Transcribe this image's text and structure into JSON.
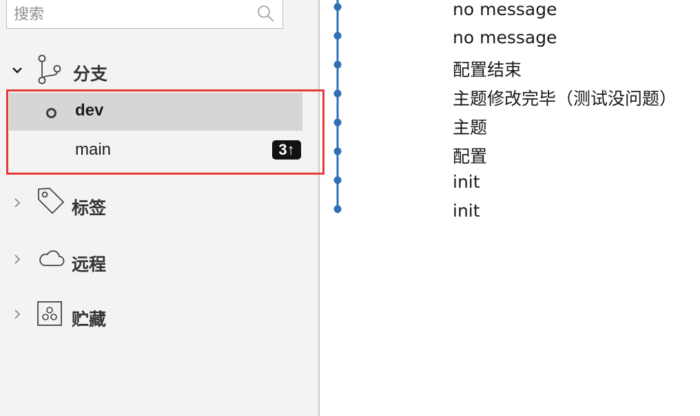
{
  "sidebar": {
    "search_placeholder": "搜索",
    "sections": {
      "branches": "分支",
      "tags": "标签",
      "remotes": "远程",
      "stashes": "贮藏"
    },
    "branches": [
      {
        "name": "dev",
        "current": true,
        "badge": ""
      },
      {
        "name": "main",
        "current": false,
        "badge": "3↑"
      }
    ]
  },
  "commits": [
    {
      "message": "no message"
    },
    {
      "message": "no message"
    },
    {
      "message": "配置结束"
    },
    {
      "message": "主题修改完毕（测试没问题）"
    },
    {
      "message": "主题"
    },
    {
      "message": "配置"
    },
    {
      "message": "init"
    },
    {
      "message": "init"
    }
  ],
  "colors": {
    "graph_line": "#2f6fb5",
    "highlight": "#e53935",
    "sidebar_bg": "#f3f3f3",
    "selected_row": "#d6d6d6"
  }
}
